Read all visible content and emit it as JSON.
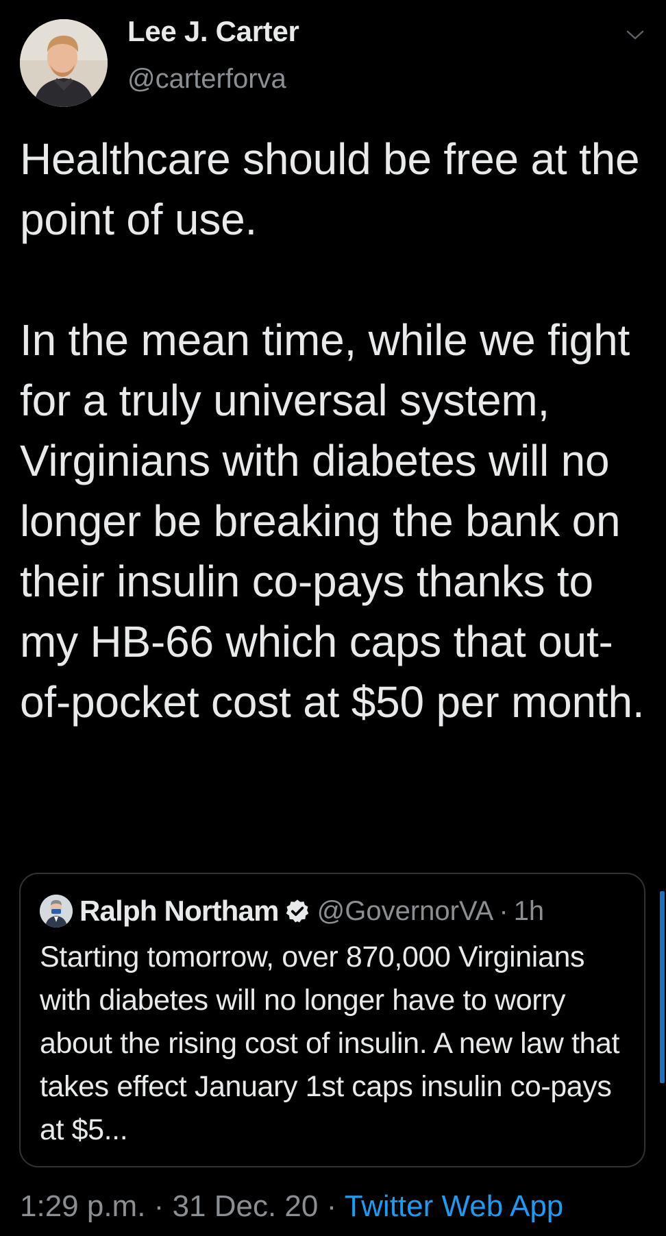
{
  "author": {
    "name": "Lee J. Carter",
    "handle": "@carterforva"
  },
  "tweet": {
    "text": "Healthcare should be free at the point of use.\n\nIn the mean time, while we fight for a truly universal system, Virginians with diabetes will no longer be breaking the bank on their insulin co-pays thanks to my HB-66 which caps that out-of-pocket cost at $50 per month."
  },
  "quote": {
    "name": "Ralph Northam",
    "verified": true,
    "handle": "@GovernorVA",
    "separator": "·",
    "time": "1h",
    "text": "Starting tomorrow, over 870,000 Virginians with diabetes will no longer have to worry about the rising cost of insulin. A new law that takes effect January 1st caps insulin co-pays at $5..."
  },
  "footer": {
    "time": "1:29 p.m.",
    "sep1": "·",
    "date": "31 Dec. 20",
    "sep2": "·",
    "source": "Twitter Web App"
  },
  "colors": {
    "background": "#000000",
    "text": "#e7e9ea",
    "secondary": "#8b8f93",
    "link": "#1d9bf0",
    "border": "#2f3336"
  },
  "icons": {
    "caret": "chevron-down-icon",
    "verified": "verified-badge-icon"
  }
}
